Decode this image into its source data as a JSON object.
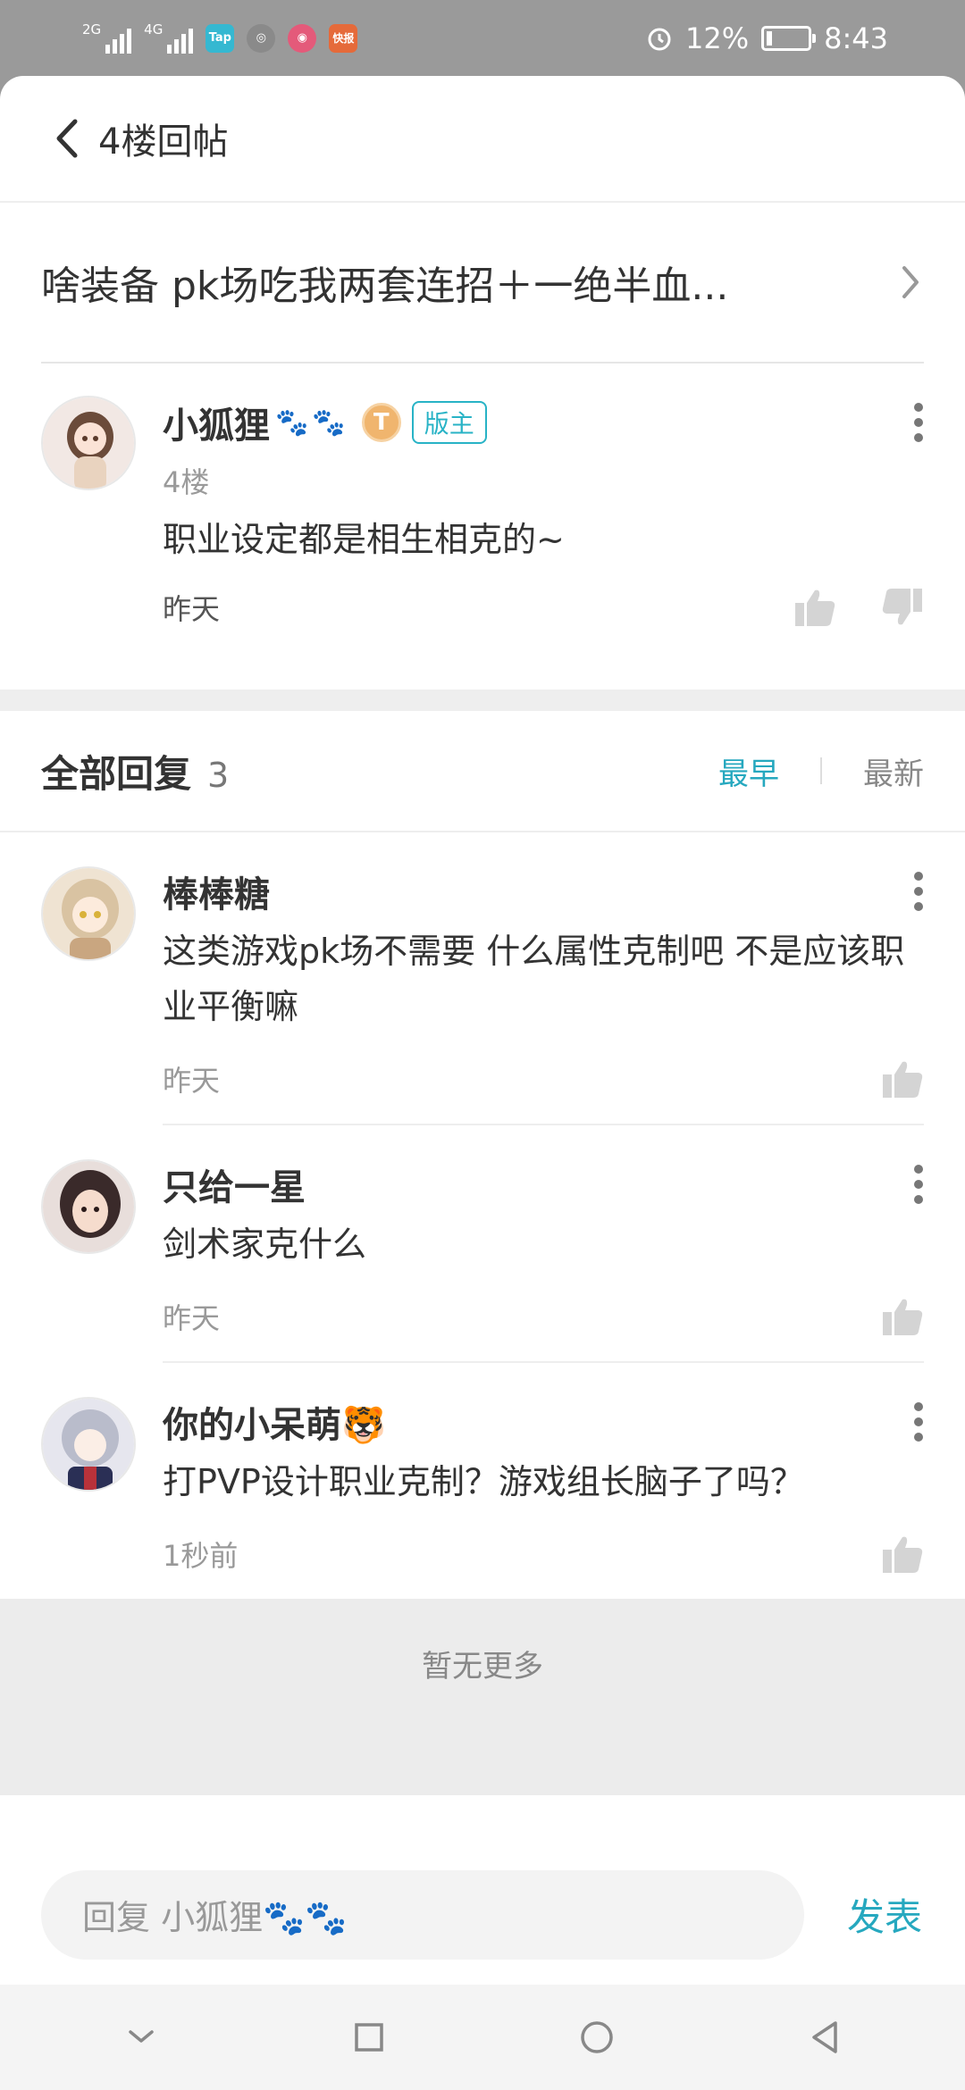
{
  "status_bar": {
    "net1": "2G",
    "net2": "4G",
    "apps": [
      {
        "label": "Tap",
        "color": "#35b8d1",
        "icon": "taptap-icon"
      },
      {
        "label": "◎",
        "color": "#8a8a8a",
        "icon": "browser-icon"
      },
      {
        "label": "◉",
        "color": "#e45a7a",
        "icon": "app-icon"
      },
      {
        "label": "快报",
        "color": "#e56a3a",
        "icon": "news-icon"
      }
    ],
    "battery": "12%",
    "time": "8:43"
  },
  "header": {
    "title": "4楼回帖"
  },
  "post_link": {
    "text": "啥装备  pk场吃我两套连招＋一绝半血..."
  },
  "floor": {
    "author": "小狐狸",
    "paws": "🐾🐾",
    "level": "T",
    "badge": "版主",
    "floor_no": "4楼",
    "content": "职业设定都是相生相克的~",
    "time": "昨天"
  },
  "replies_header": {
    "title": "全部回复",
    "count": "3",
    "sort_earliest": "最早",
    "sort_latest": "最新"
  },
  "replies": [
    {
      "author": "棒棒糖",
      "content": "这类游戏pk场不需要 什么属性克制吧  不是应该职业平衡嘛",
      "time": "昨天"
    },
    {
      "author": "只给一星",
      "content": "剑术家克什么",
      "time": "昨天"
    },
    {
      "author": "你的小呆萌🐯",
      "content": "打PVP设计职业克制？游戏组长脑子了吗？",
      "time": "1秒前"
    }
  ],
  "footer": {
    "no_more": "暂无更多"
  },
  "composer": {
    "placeholder": "回复 小狐狸🐾🐾",
    "send": "发表"
  },
  "colors": {
    "accent": "#26a8bf",
    "mod_badge": "#28b3c6",
    "paws": "#d13a3a"
  }
}
